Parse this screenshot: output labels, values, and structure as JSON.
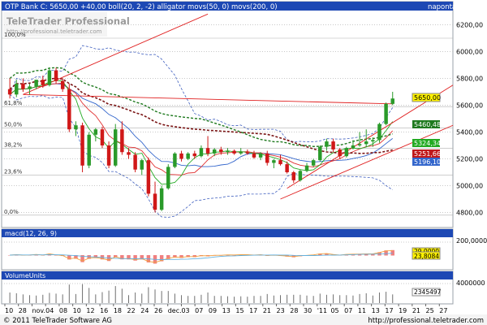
{
  "header": {
    "title": "OTP Bank C: 5650,00 +40,00 boll(20, 2, -2) alligator movs(50, 0) movs(200, 0)",
    "right_label": "naponta",
    "watermark_name": "TeleTrader Professional",
    "watermark_url": "http://professional.teletrader.com"
  },
  "colors": {
    "title_bar": "#1d48b4",
    "pane_bg": "#ffffff",
    "grid": "#c8c8c8",
    "bull_candle": "#2a9a2a",
    "bear_candle": "#d01818",
    "boll_band": "#3f5fbf",
    "ma50": "#1f7a1f",
    "ma200": "#7a1414",
    "alligator_jaw": "#3366cc",
    "alligator_teeth": "#e03030",
    "alligator_lips": "#22aa22",
    "trendline": "#e02020",
    "price_tag": "#fff200",
    "macd_hist": "#f08080",
    "macd_line": "#f0a040",
    "macd_signal": "#60b0e0"
  },
  "price_pane": {
    "fib_labels": [
      "100,0%",
      "61,8%",
      "50,0%",
      "38,2%",
      "23,6%",
      "0,0%"
    ],
    "y_ticks": [
      "6200,00",
      "6000,00",
      "5800,00",
      "5600,00",
      "5400,00",
      "5200,00",
      "5000,00",
      "4800,00"
    ],
    "tags": {
      "last": "5650,00",
      "ma50": "5460,48",
      "level1": "5324,34",
      "level2": "5251,66",
      "level3": "5196,10"
    }
  },
  "macd_pane": {
    "title": "macd(12, 26, 9)",
    "y_ticks": [
      "200,0000"
    ],
    "tags": {
      "value": "23,8084",
      "upper": "29,0000"
    }
  },
  "volume_pane": {
    "title": "VolumeUnits",
    "y_ticks": [
      "4000000"
    ],
    "tags": {
      "value": "2345497"
    }
  },
  "x_axis": {
    "labels": [
      "10",
      "28",
      "nov.",
      "04",
      "08",
      "10",
      "12",
      "16",
      "18",
      "22",
      "24",
      "26",
      "dec.",
      "03",
      "07",
      "09",
      "13",
      "15",
      "17",
      "21",
      "23",
      "28",
      "30",
      "'11",
      "05",
      "07",
      "11",
      "13",
      "17",
      "19",
      "21",
      "25",
      "27"
    ]
  },
  "footer": {
    "copyright": "© 2011 TeleTrader Software AG",
    "url": "http://professional.teletrader.com"
  },
  "chart_data": {
    "type": "candlestick",
    "title": "OTP Bank C: 5650,00 +40,00",
    "ylim": [
      4700,
      6300
    ],
    "y_ticks": [
      6200,
      6000,
      5800,
      5600,
      5400,
      5200,
      5000,
      4800
    ],
    "fib_levels": [
      {
        "label": "100,0%",
        "value": 6100
      },
      {
        "label": "61,8%",
        "value": 5590
      },
      {
        "label": "50,0%",
        "value": 5430
      },
      {
        "label": "38,2%",
        "value": 5280
      },
      {
        "label": "23,6%",
        "value": 5080
      },
      {
        "label": "0,0%",
        "value": 4780
      }
    ],
    "candles": [
      {
        "o": 5720,
        "h": 5800,
        "l": 5650,
        "c": 5680
      },
      {
        "o": 5680,
        "h": 5790,
        "l": 5660,
        "c": 5760
      },
      {
        "o": 5760,
        "h": 5800,
        "l": 5700,
        "c": 5720
      },
      {
        "o": 5720,
        "h": 5760,
        "l": 5680,
        "c": 5740
      },
      {
        "o": 5740,
        "h": 5790,
        "l": 5720,
        "c": 5790
      },
      {
        "o": 5790,
        "h": 5820,
        "l": 5730,
        "c": 5750
      },
      {
        "o": 5750,
        "h": 5880,
        "l": 5740,
        "c": 5860
      },
      {
        "o": 5860,
        "h": 5880,
        "l": 5760,
        "c": 5780
      },
      {
        "o": 5780,
        "h": 5800,
        "l": 5700,
        "c": 5720
      },
      {
        "o": 5720,
        "h": 5760,
        "l": 5400,
        "c": 5420
      },
      {
        "o": 5420,
        "h": 5480,
        "l": 5370,
        "c": 5450
      },
      {
        "o": 5450,
        "h": 5470,
        "l": 5100,
        "c": 5150
      },
      {
        "o": 5150,
        "h": 5400,
        "l": 5130,
        "c": 5380
      },
      {
        "o": 5380,
        "h": 5430,
        "l": 5330,
        "c": 5420
      },
      {
        "o": 5420,
        "h": 5440,
        "l": 5280,
        "c": 5300
      },
      {
        "o": 5300,
        "h": 5330,
        "l": 5130,
        "c": 5150
      },
      {
        "o": 5150,
        "h": 5460,
        "l": 5140,
        "c": 5420
      },
      {
        "o": 5420,
        "h": 5480,
        "l": 5230,
        "c": 5250
      },
      {
        "o": 5250,
        "h": 5280,
        "l": 5200,
        "c": 5230
      },
      {
        "o": 5230,
        "h": 5250,
        "l": 5100,
        "c": 5120
      },
      {
        "o": 5120,
        "h": 5200,
        "l": 5080,
        "c": 5190
      },
      {
        "o": 5190,
        "h": 5210,
        "l": 4920,
        "c": 4940
      },
      {
        "o": 4940,
        "h": 5030,
        "l": 4800,
        "c": 4820
      },
      {
        "o": 4820,
        "h": 5000,
        "l": 4810,
        "c": 4980
      },
      {
        "o": 4980,
        "h": 5160,
        "l": 4970,
        "c": 5140
      },
      {
        "o": 5140,
        "h": 5250,
        "l": 5130,
        "c": 5240
      },
      {
        "o": 5240,
        "h": 5260,
        "l": 5180,
        "c": 5200
      },
      {
        "o": 5200,
        "h": 5250,
        "l": 5190,
        "c": 5240
      },
      {
        "o": 5240,
        "h": 5260,
        "l": 5200,
        "c": 5220
      },
      {
        "o": 5220,
        "h": 5300,
        "l": 5210,
        "c": 5280
      },
      {
        "o": 5280,
        "h": 5370,
        "l": 5220,
        "c": 5240
      },
      {
        "o": 5240,
        "h": 5280,
        "l": 5220,
        "c": 5270
      },
      {
        "o": 5270,
        "h": 5290,
        "l": 5230,
        "c": 5250
      },
      {
        "o": 5250,
        "h": 5280,
        "l": 5230,
        "c": 5260
      },
      {
        "o": 5260,
        "h": 5270,
        "l": 5230,
        "c": 5240
      },
      {
        "o": 5240,
        "h": 5280,
        "l": 5230,
        "c": 5250
      },
      {
        "o": 5250,
        "h": 5270,
        "l": 5230,
        "c": 5240
      },
      {
        "o": 5240,
        "h": 5260,
        "l": 5200,
        "c": 5210
      },
      {
        "o": 5210,
        "h": 5250,
        "l": 5190,
        "c": 5240
      },
      {
        "o": 5240,
        "h": 5260,
        "l": 5150,
        "c": 5170
      },
      {
        "o": 5170,
        "h": 5200,
        "l": 5130,
        "c": 5190
      },
      {
        "o": 5190,
        "h": 5230,
        "l": 5150,
        "c": 5160
      },
      {
        "o": 5160,
        "h": 5180,
        "l": 5090,
        "c": 5100
      },
      {
        "o": 5100,
        "h": 5110,
        "l": 5020,
        "c": 5040
      },
      {
        "o": 5040,
        "h": 5120,
        "l": 5030,
        "c": 5110
      },
      {
        "o": 5110,
        "h": 5170,
        "l": 5100,
        "c": 5150
      },
      {
        "o": 5150,
        "h": 5200,
        "l": 5140,
        "c": 5190
      },
      {
        "o": 5190,
        "h": 5300,
        "l": 5180,
        "c": 5290
      },
      {
        "o": 5290,
        "h": 5350,
        "l": 5260,
        "c": 5330
      },
      {
        "o": 5330,
        "h": 5350,
        "l": 5250,
        "c": 5270
      },
      {
        "o": 5270,
        "h": 5280,
        "l": 5200,
        "c": 5220
      },
      {
        "o": 5220,
        "h": 5290,
        "l": 5210,
        "c": 5280
      },
      {
        "o": 5280,
        "h": 5340,
        "l": 5270,
        "c": 5300
      },
      {
        "o": 5300,
        "h": 5400,
        "l": 5290,
        "c": 5310
      },
      {
        "o": 5310,
        "h": 5420,
        "l": 5290,
        "c": 5330
      },
      {
        "o": 5330,
        "h": 5360,
        "l": 5290,
        "c": 5340
      },
      {
        "o": 5340,
        "h": 5470,
        "l": 5320,
        "c": 5460
      },
      {
        "o": 5460,
        "h": 5620,
        "l": 5450,
        "c": 5610
      },
      {
        "o": 5610,
        "h": 5700,
        "l": 5600,
        "c": 5650
      }
    ],
    "macd": {
      "value": 23.8084,
      "upper": 29.0,
      "ytick": 200.0
    },
    "volume": {
      "value": 2345497,
      "ytick": 4000000
    }
  }
}
